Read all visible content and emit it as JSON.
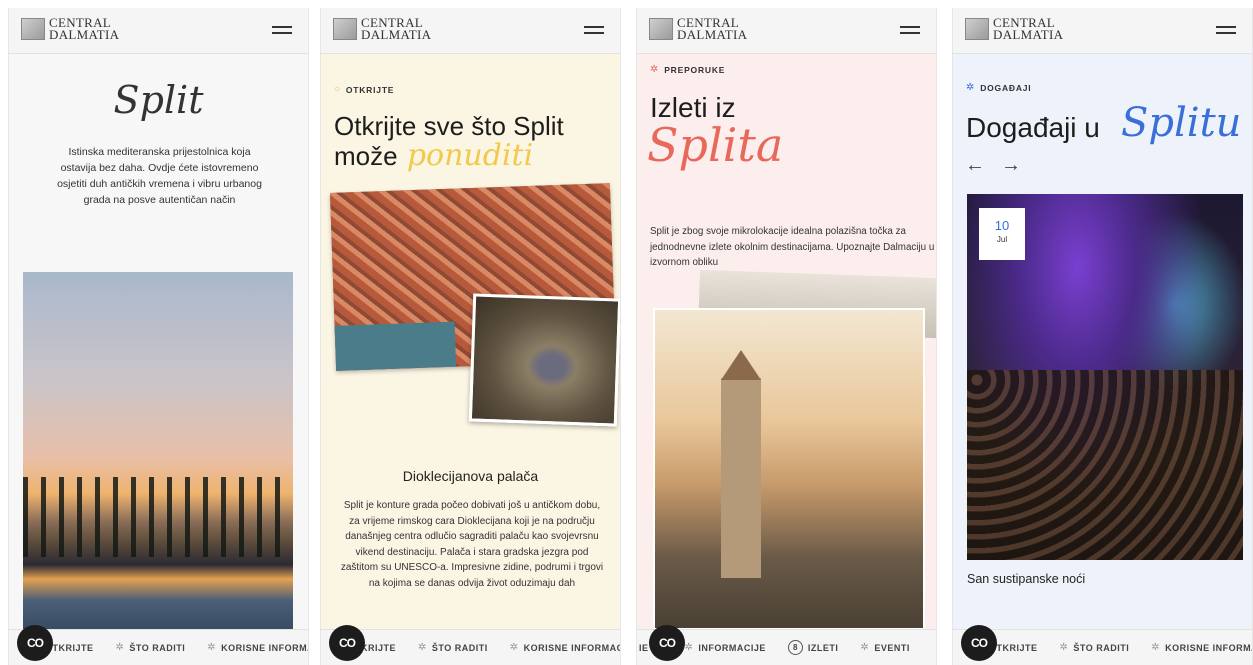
{
  "brand": {
    "line1": "CENTRAL",
    "line2": "DALMATIA"
  },
  "panel1": {
    "script_title": "Split",
    "intro": "Istinska mediteranska prijestolnica koja ostavija bez daha. Ovdje ćete istovremeno osjetiti duh antičkih vremena i vibru urbanog grada na posve autentičan način",
    "nav": [
      "OTKRIJTE",
      "ŠTO RADITI",
      "KORISNE INFORMAC"
    ]
  },
  "panel2": {
    "eyebrow": "OTKRIJTE",
    "heading_line1": "Otkrijte sve što Split",
    "heading_line2": "može",
    "heading_script": "ponuditi",
    "subheading": "Dioklecijanova palača",
    "body": "Split je konture grada počeo dobivati još u antičkom dobu, za vrijeme rimskog cara Dioklecijana koji je na području današnjeg centra odlučio sagraditi palaču kao svojevrsnu vikend destinaciju. Palača i stara gradska jezgra pod zaštitom su UNESCO-a. Impresivne zidine, podrumi i trgovi na kojima se danas odvija život oduzimaju dah",
    "nav": [
      "KRIJTE",
      "ŠTO RADITI",
      "KORISNE INFORMACI"
    ]
  },
  "panel3": {
    "eyebrow": "PREPORUKE",
    "heading": "Izleti iz",
    "heading_script": "Splita",
    "body": "Split je zbog svoje mikrolokacije idealna polazišna točka za jednodnevne izlete okolnim destinacijama. Upoznajte Dalmaciju u izvornom obliku",
    "nav": [
      "IE",
      "INFORMACIJE",
      "IZLETI",
      "EVENTI"
    ],
    "nav_badge": "8"
  },
  "panel4": {
    "eyebrow": "DOGAĐAJI",
    "heading": "Događaji u",
    "heading_script": "Splitu",
    "date_day": "10",
    "date_month": "Jul",
    "event_title": "San sustipanske noći",
    "nav": [
      "OTKRIJTE",
      "ŠTO RADITI",
      "KORISNE INFORMAC"
    ]
  },
  "fab_label": "CO",
  "icons": {
    "menu": "hamburger-icon",
    "nav": "gear-icon",
    "prev": "arrow-left-icon",
    "next": "arrow-right-icon",
    "fab": "co-logo-icon"
  },
  "colors": {
    "yellow_accent": "#f2c94c",
    "pink_accent": "#e8685a",
    "blue_accent": "#3b6fd8"
  }
}
